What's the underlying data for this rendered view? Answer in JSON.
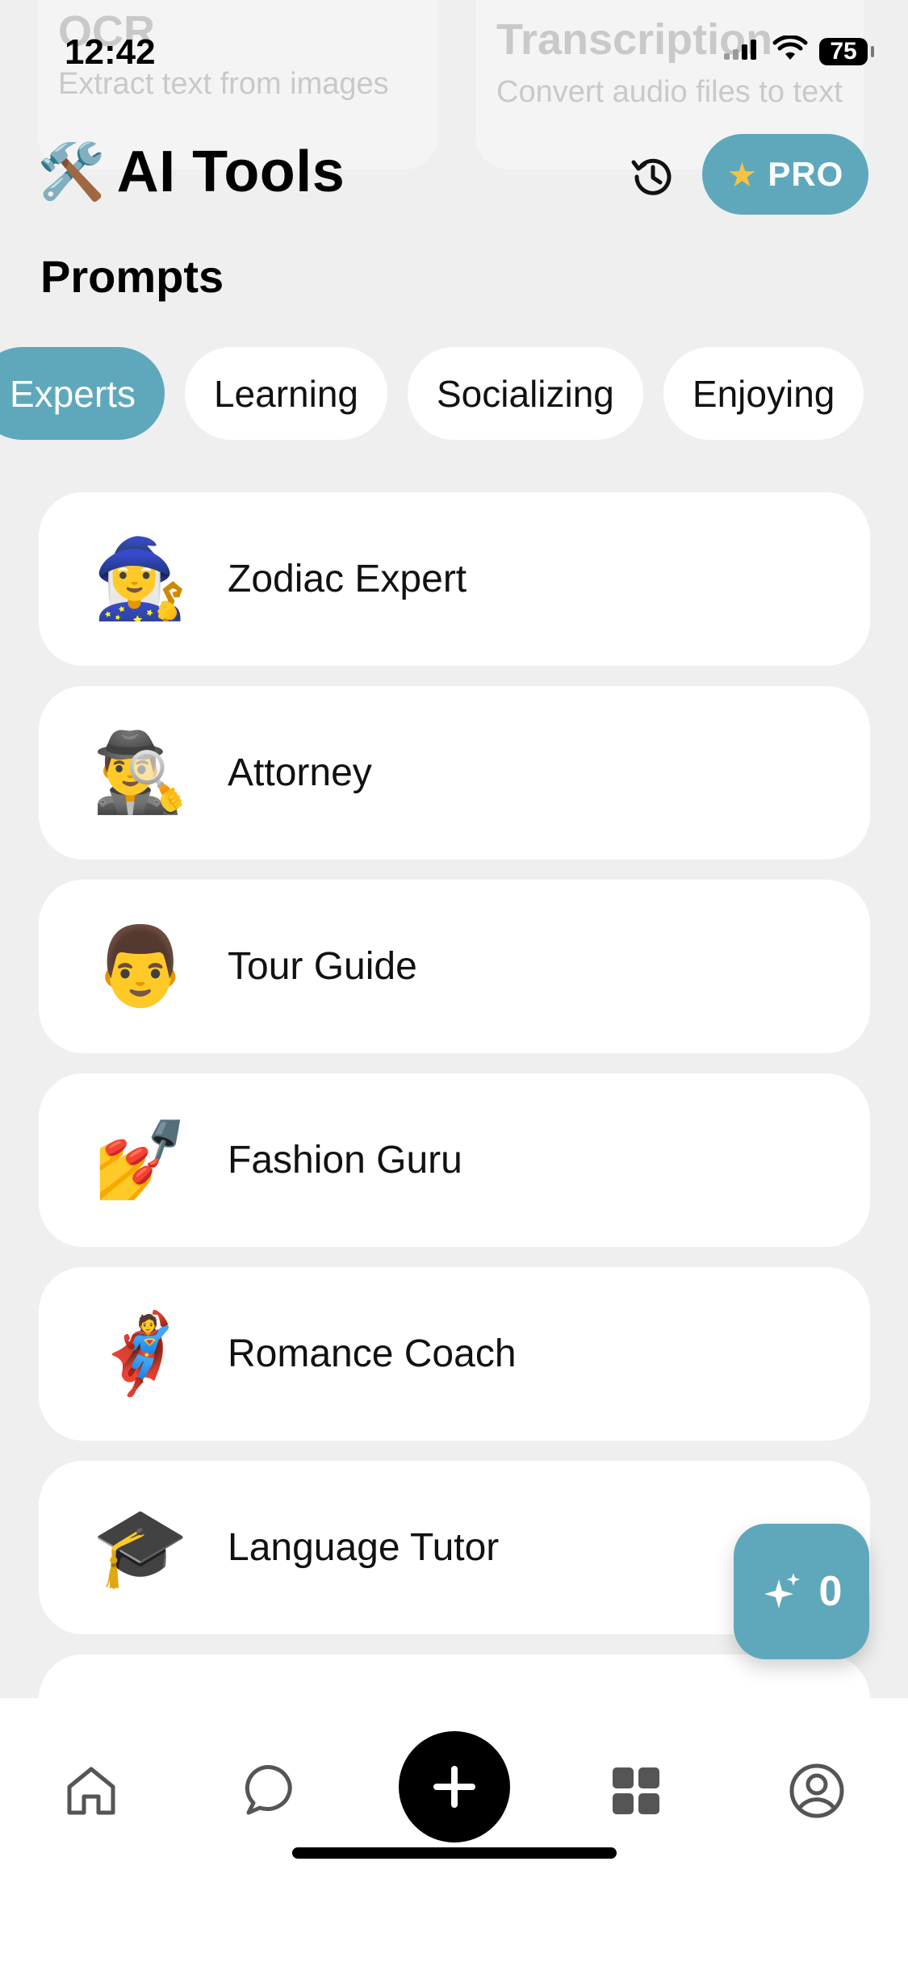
{
  "background_cards": [
    {
      "title": "OCR",
      "desc": "Extract text from images"
    },
    {
      "title": "Transcription",
      "desc": "Convert audio files to text"
    }
  ],
  "status_bar": {
    "time": "12:42",
    "battery": "75"
  },
  "header": {
    "title_emoji": "🛠️",
    "title": "AI Tools",
    "pro_label": "PRO"
  },
  "section": {
    "title": "Prompts"
  },
  "tabs": [
    {
      "label": "Experts",
      "active": true
    },
    {
      "label": "Learning"
    },
    {
      "label": "Socializing"
    },
    {
      "label": "Enjoying"
    }
  ],
  "prompts": [
    {
      "emoji": "🧙‍♀️",
      "label": "Zodiac Expert"
    },
    {
      "emoji": "🕵️‍♂️",
      "label": "Attorney"
    },
    {
      "emoji": "👨",
      "label": "Tour Guide"
    },
    {
      "emoji": "💅",
      "label": "Fashion Guru"
    },
    {
      "emoji": "🦸",
      "label": "Romance Coach"
    },
    {
      "emoji": "🎓",
      "label": "Language Tutor"
    }
  ],
  "fab": {
    "count": "0"
  },
  "bottom_nav": [
    "home",
    "chat",
    "add",
    "apps",
    "profile"
  ],
  "colors": {
    "accent": "#5fa8bb",
    "background": "#efefef",
    "card": "#ffffff"
  }
}
